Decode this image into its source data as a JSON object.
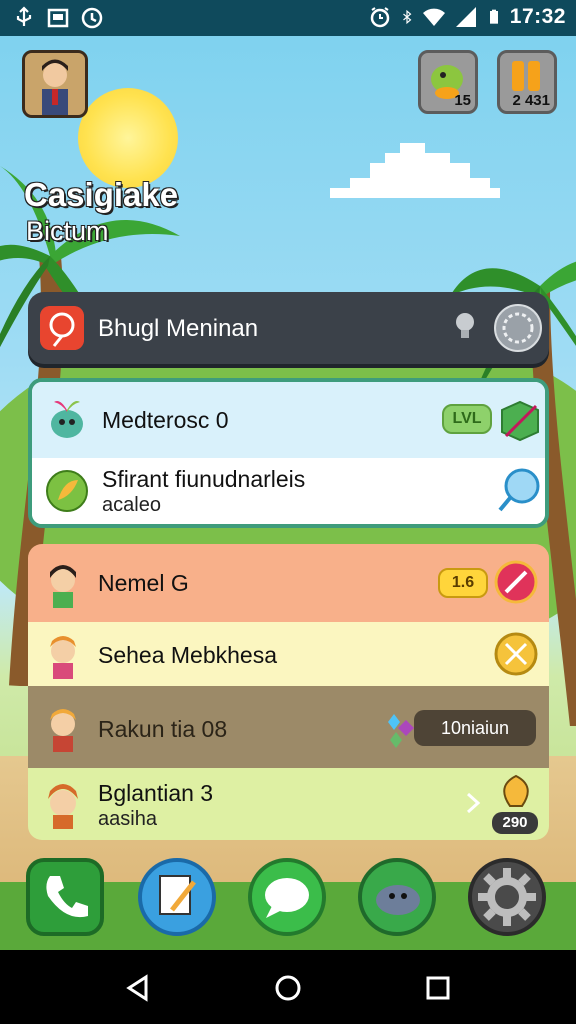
{
  "status_bar": {
    "time": "17:32",
    "left_icons": [
      "usb-icon",
      "screenshot-icon",
      "clock-icon"
    ],
    "right_icons": [
      "alarm-icon",
      "bluetooth-icon",
      "wifi-icon",
      "signal-icon",
      "battery-icon"
    ]
  },
  "header": {
    "title": "Casigiake",
    "subtitle": "Bictum",
    "counters": [
      {
        "icon": "turtle-icon",
        "value": "15"
      },
      {
        "icon": "coins-icon",
        "value": "2 431"
      }
    ]
  },
  "search": {
    "label": "Bhugl Meninan"
  },
  "group1": [
    {
      "title": "Medterosc 0",
      "badge": "LVL"
    },
    {
      "title": "Sfirant fiunudnarleis",
      "subtitle": "acaleo"
    }
  ],
  "group2": [
    {
      "title": "Nemel G",
      "badge": "1.6"
    },
    {
      "title": "Sehea Mebkhesa"
    },
    {
      "title": "Rakun tia 08",
      "badge": "10niaiun"
    },
    {
      "title": "Bglantian 3",
      "subtitle": "aasiha",
      "badge": "290"
    }
  ],
  "dock": [
    "phone",
    "notes",
    "messages",
    "chat",
    "settings"
  ],
  "colors": {
    "status_bar": "#0f4a5c",
    "search_bar": "#3b4149",
    "row_blue": "#d9f1fb",
    "row_orange": "#f8b08a",
    "row_yellow": "#fbf6c0",
    "row_olive": "#9c8a68",
    "row_lime": "#def0a3"
  }
}
